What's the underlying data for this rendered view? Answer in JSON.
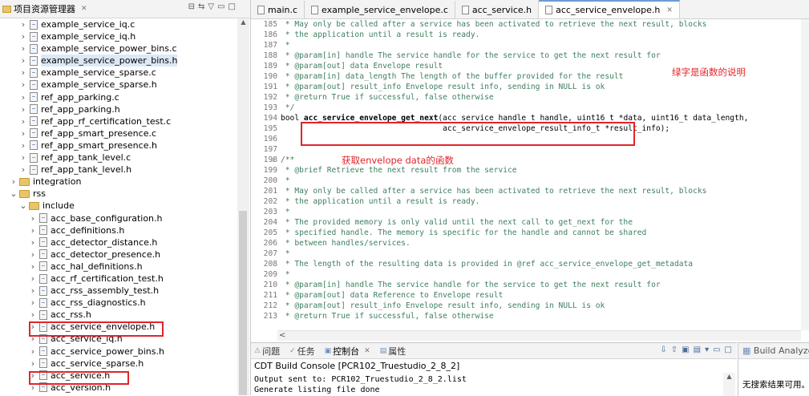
{
  "explorer": {
    "title": "项目资源管理器",
    "items": [
      {
        "label": "example_service_iq.c",
        "kind": "file",
        "expanded": null
      },
      {
        "label": "example_service_iq.h",
        "kind": "file",
        "expanded": null
      },
      {
        "label": "example_service_power_bins.c",
        "kind": "file",
        "expanded": null
      },
      {
        "label": "example_service_power_bins.h",
        "kind": "file",
        "expanded": null,
        "selected": true
      },
      {
        "label": "example_service_sparse.c",
        "kind": "file",
        "expanded": null
      },
      {
        "label": "example_service_sparse.h",
        "kind": "file",
        "expanded": null
      },
      {
        "label": "ref_app_parking.c",
        "kind": "file",
        "expanded": null
      },
      {
        "label": "ref_app_parking.h",
        "kind": "file",
        "expanded": null
      },
      {
        "label": "ref_app_rf_certification_test.c",
        "kind": "file",
        "expanded": null
      },
      {
        "label": "ref_app_smart_presence.c",
        "kind": "file",
        "expanded": null
      },
      {
        "label": "ref_app_smart_presence.h",
        "kind": "file",
        "expanded": null
      },
      {
        "label": "ref_app_tank_level.c",
        "kind": "file",
        "expanded": null
      },
      {
        "label": "ref_app_tank_level.h",
        "kind": "file",
        "expanded": null
      },
      {
        "label": "integration",
        "kind": "folder",
        "expanded": false
      },
      {
        "label": "rss",
        "kind": "folder",
        "expanded": true
      },
      {
        "label": "include",
        "kind": "folder",
        "expanded": true
      },
      {
        "label": "acc_base_configuration.h",
        "kind": "file",
        "expanded": null
      },
      {
        "label": "acc_definitions.h",
        "kind": "file",
        "expanded": null
      },
      {
        "label": "acc_detector_distance.h",
        "kind": "file",
        "expanded": null
      },
      {
        "label": "acc_detector_presence.h",
        "kind": "file",
        "expanded": null
      },
      {
        "label": "acc_hal_definitions.h",
        "kind": "file",
        "expanded": null
      },
      {
        "label": "acc_rf_certification_test.h",
        "kind": "file",
        "expanded": null
      },
      {
        "label": "acc_rss_assembly_test.h",
        "kind": "file",
        "expanded": null
      },
      {
        "label": "acc_rss_diagnostics.h",
        "kind": "file",
        "expanded": null
      },
      {
        "label": "acc_rss.h",
        "kind": "file",
        "expanded": null
      },
      {
        "label": "acc_service_envelope.h",
        "kind": "file",
        "expanded": null
      },
      {
        "label": "acc_service_iq.h",
        "kind": "file",
        "expanded": null
      },
      {
        "label": "acc_service_power_bins.h",
        "kind": "file",
        "expanded": null
      },
      {
        "label": "acc_service_sparse.h",
        "kind": "file",
        "expanded": null
      },
      {
        "label": "acc_service.h",
        "kind": "file",
        "expanded": null
      },
      {
        "label": "acc_version.h",
        "kind": "file",
        "expanded": null
      }
    ]
  },
  "editor": {
    "tabs": [
      {
        "label": "main.c",
        "active": false
      },
      {
        "label": "example_service_envelope.c",
        "active": false
      },
      {
        "label": "acc_service.h",
        "active": false
      },
      {
        "label": "acc_service_envelope.h",
        "active": true
      }
    ],
    "lines": [
      {
        "n": "185",
        "text": " * May only be called after a service has been activated to retrieve the next result, blocks",
        "kind": "comment"
      },
      {
        "n": "186",
        "text": " * the application until a result is ready.",
        "kind": "comment"
      },
      {
        "n": "187",
        "text": " *",
        "kind": "comment"
      },
      {
        "n": "188",
        "text": " * @param[in] handle The service handle for the service to get the next result for",
        "kind": "comment"
      },
      {
        "n": "189",
        "text": " * @param[out] data Envelope result",
        "kind": "comment"
      },
      {
        "n": "190",
        "text": " * @param[in] data_length The length of the buffer provided for the result",
        "kind": "comment"
      },
      {
        "n": "191",
        "text": " * @param[out] result_info Envelope result info, sending in NULL is ok",
        "kind": "comment"
      },
      {
        "n": "192",
        "text": " * @return True if successful, false otherwise",
        "kind": "comment"
      },
      {
        "n": "193",
        "text": " */",
        "kind": "comment"
      },
      {
        "n": "194",
        "kw": "bool",
        "fn": "acc_service_envelope_get_next",
        "rest": "(acc_service_handle_t handle, uint16_t *data, uint16_t data_length,",
        "kind": "code"
      },
      {
        "n": "195",
        "text": "                                   acc_service_envelope_result_info_t *result_info);",
        "kind": "code"
      },
      {
        "n": "196",
        "text": "",
        "kind": "code"
      },
      {
        "n": "197",
        "text": "",
        "kind": "code"
      },
      {
        "n": "198",
        "text": "/**",
        "kind": "comment",
        "fold": true
      },
      {
        "n": "199",
        "text": " * @brief Retrieve the next result from the service",
        "kind": "comment"
      },
      {
        "n": "200",
        "text": " *",
        "kind": "comment"
      },
      {
        "n": "201",
        "text": " * May only be called after a service has been activated to retrieve the next result, blocks",
        "kind": "comment"
      },
      {
        "n": "202",
        "text": " * the application until a result is ready.",
        "kind": "comment"
      },
      {
        "n": "203",
        "text": " *",
        "kind": "comment"
      },
      {
        "n": "204",
        "text": " * The provided memory is only valid until the next call to get_next for the",
        "kind": "comment"
      },
      {
        "n": "205",
        "text": " * specified handle. The memory is specific for the handle and cannot be shared",
        "kind": "comment"
      },
      {
        "n": "206",
        "text": " * between handles/services.",
        "kind": "comment"
      },
      {
        "n": "207",
        "text": " *",
        "kind": "comment"
      },
      {
        "n": "208",
        "text": " * The length of the resulting data is provided in @ref acc_service_envelope_get_metadata",
        "kind": "comment"
      },
      {
        "n": "209",
        "text": " *",
        "kind": "comment"
      },
      {
        "n": "210",
        "text": " * @param[in] handle The service handle for the service to get the next result for",
        "kind": "comment"
      },
      {
        "n": "211",
        "text": " * @param[out] data Reference to Envelope result",
        "kind": "comment"
      },
      {
        "n": "212",
        "text": " * @param[out] result_info Envelope result info, sending in NULL is ok",
        "kind": "comment"
      },
      {
        "n": "213",
        "text": " * @return True if successful, false otherwise",
        "kind": "comment"
      }
    ],
    "annotation_green": "绿字是函数的说明",
    "annotation_function": "获取envelope data的函数"
  },
  "console": {
    "tabs": [
      {
        "label": "问题",
        "active": false
      },
      {
        "label": "任务",
        "active": false
      },
      {
        "label": "控制台",
        "active": true
      },
      {
        "label": "属性",
        "active": false
      }
    ],
    "header": "CDT Build Console [PCR102_Truestudio_2_8_2]",
    "output": [
      "Output sent to: PCR102_Truestudio_2_8_2.list",
      "Generate listing file done"
    ]
  },
  "analyzer": {
    "title": "Build Analyzer",
    "message": "无搜索结果可用。如"
  },
  "colors": {
    "annotation_red": "#e0252a",
    "comment_green": "#3f7f5f",
    "keyword": "#7f0055"
  }
}
